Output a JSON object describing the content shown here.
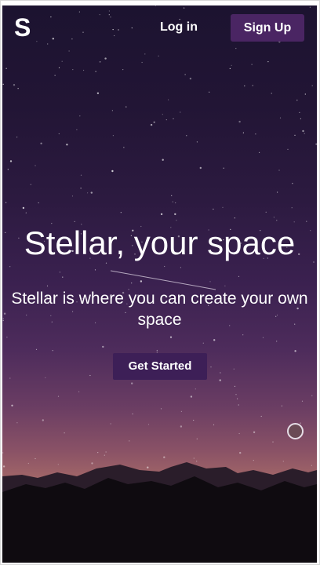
{
  "header": {
    "logo": "S",
    "login_label": "Log in",
    "signup_label": "Sign Up"
  },
  "hero": {
    "title": "Stellar, your space",
    "subtitle": "Stellar is where you can create your own space",
    "cta_label": "Get Started"
  },
  "colors": {
    "accent": "#4a2563",
    "text": "#ffffff"
  }
}
